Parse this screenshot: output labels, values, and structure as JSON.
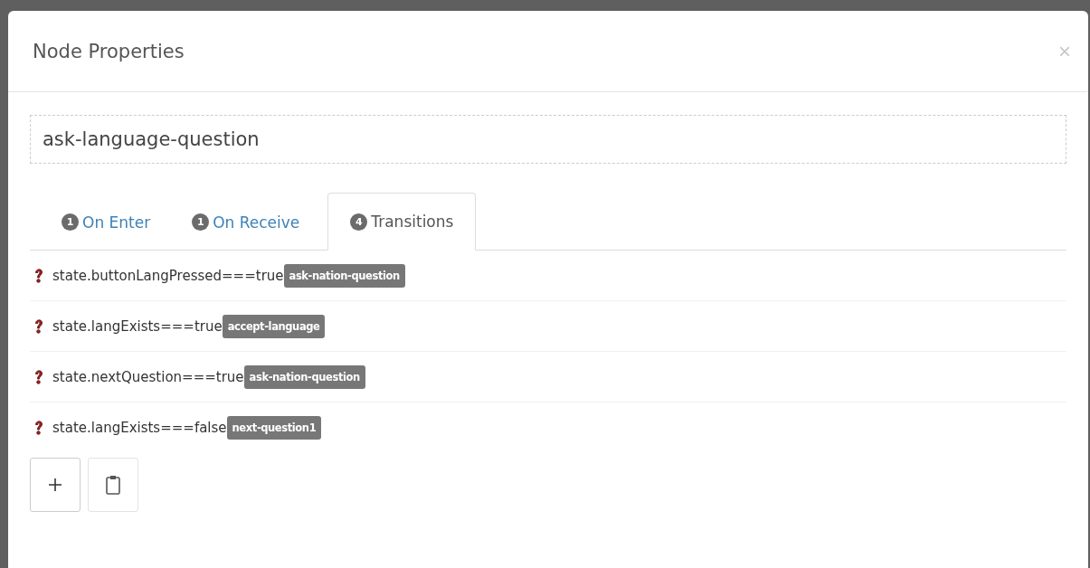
{
  "dialog": {
    "title": "Node Properties",
    "close": "×"
  },
  "name_field": {
    "value": "ask-language-question"
  },
  "tabs": [
    {
      "count": "1",
      "label": "On Enter",
      "selected": false
    },
    {
      "count": "1",
      "label": "On Receive",
      "selected": false
    },
    {
      "count": "4",
      "label": "Transitions",
      "selected": true
    }
  ],
  "transitions": [
    {
      "condition": "state.buttonLangPressed===true",
      "target": "ask-nation-question"
    },
    {
      "condition": "state.langExists===true",
      "target": "accept-language"
    },
    {
      "condition": "state.nextQuestion===true",
      "target": "ask-nation-question"
    },
    {
      "condition": "state.langExists===false",
      "target": "next-question1"
    }
  ],
  "buttons": [
    {
      "kind": "add"
    },
    {
      "kind": "paste"
    }
  ]
}
